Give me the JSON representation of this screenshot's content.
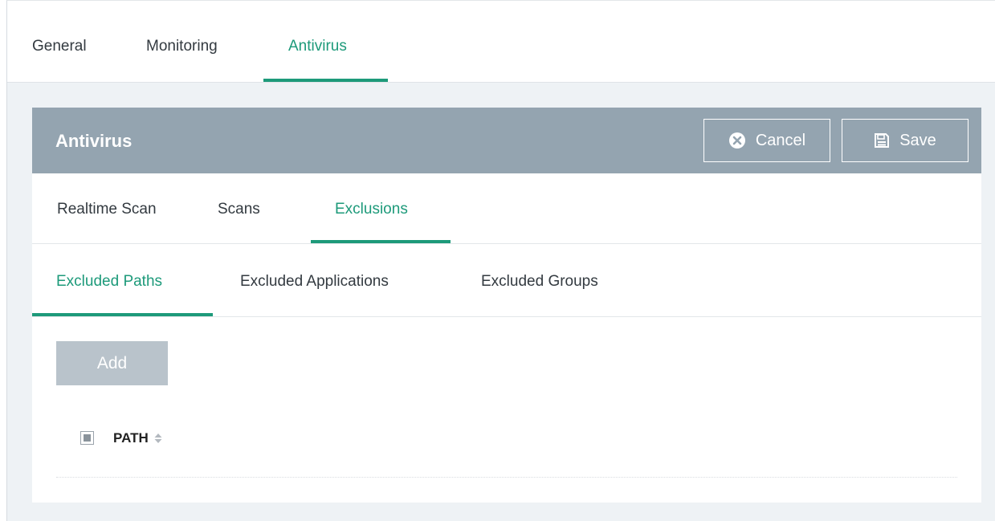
{
  "top_tabs": [
    {
      "label": "General"
    },
    {
      "label": "Monitoring"
    },
    {
      "label": "Antivirus"
    }
  ],
  "panel": {
    "title": "Antivirus",
    "cancel_label": "Cancel",
    "cancel_icon": "x-circle-icon",
    "save_label": "Save",
    "save_icon": "floppy-disk-icon",
    "header_color": "#94a4b0"
  },
  "section_tabs": [
    {
      "label": "Realtime Scan"
    },
    {
      "label": "Scans"
    },
    {
      "label": "Exclusions"
    }
  ],
  "exclusion_tabs": [
    {
      "label": "Excluded Paths"
    },
    {
      "label": "Excluded Applications"
    },
    {
      "label": "Excluded Groups"
    }
  ],
  "add_label": "Add",
  "table": {
    "columns": [
      {
        "label": "PATH",
        "sortable": true
      }
    ],
    "rows": []
  },
  "colors": {
    "accent": "#1d9a7a",
    "disabled_button": "#b9c3cb"
  }
}
